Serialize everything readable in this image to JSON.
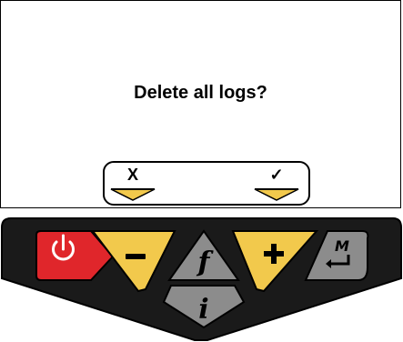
{
  "screen": {
    "prompt": "Delete all logs?",
    "softkeys": {
      "cancel_label": "X",
      "confirm_label": "✓"
    }
  },
  "keypad": {
    "buttons": [
      {
        "name": "power",
        "icon": "power-icon"
      },
      {
        "name": "minus",
        "icon": "minus-icon"
      },
      {
        "name": "function",
        "glyph": "f",
        "icon": "function-icon"
      },
      {
        "name": "plus",
        "icon": "plus-icon"
      },
      {
        "name": "memory-enter",
        "glyph": "M",
        "icon": "memory-enter-icon"
      },
      {
        "name": "info",
        "glyph": "i",
        "icon": "info-icon"
      }
    ],
    "glyphs": {
      "function": "f",
      "memory": "M",
      "info": "i"
    }
  },
  "colors": {
    "bezel": "#1a1a1a",
    "power_key": "#e0262b",
    "yellow_key": "#f2c94c",
    "grey_key": "#8c8c8c",
    "key_outline": "#000000"
  }
}
